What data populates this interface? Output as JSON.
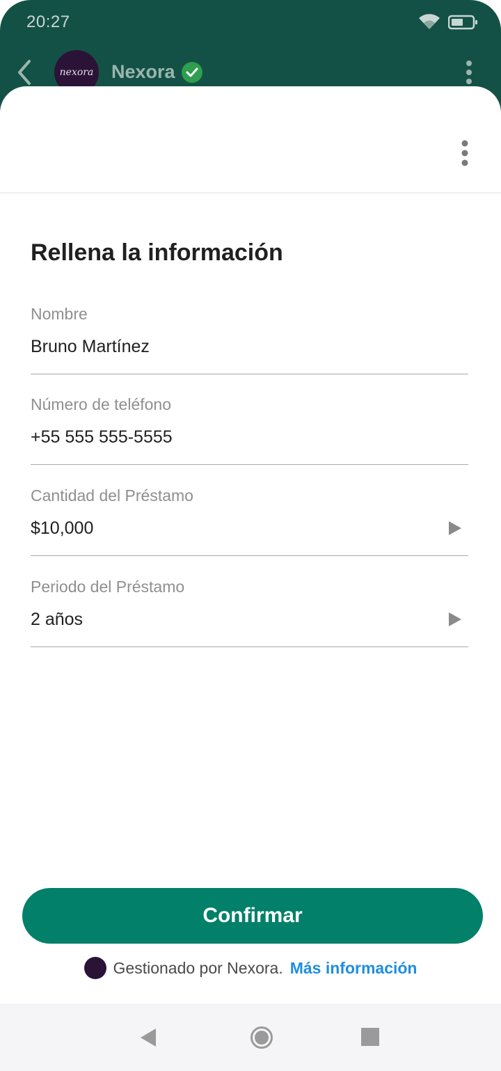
{
  "status_bar": {
    "time": "20:27"
  },
  "chat_header": {
    "title": "Nexora",
    "avatar_text": "nexora"
  },
  "form": {
    "title": "Rellena la información",
    "fields": [
      {
        "label": "Nombre",
        "value": "Bruno Martínez",
        "has_chevron": false
      },
      {
        "label": "Número de teléfono",
        "value": "+55 555 555-5555",
        "has_chevron": false
      },
      {
        "label": "Cantidad del Préstamo",
        "value": "$10,000",
        "has_chevron": true
      },
      {
        "label": "Periodo del Préstamo",
        "value": "2 años",
        "has_chevron": true
      }
    ]
  },
  "confirm_label": "Confirmar",
  "footer": {
    "managed_text": "Gestionado por Nexora.",
    "link_text": "Más información"
  },
  "colors": {
    "header_bg": "#135146",
    "accent": "#028069",
    "link": "#1f8de0",
    "verified": "#2e9e4f"
  },
  "icons": [
    "wifi-icon",
    "battery-icon",
    "back-arrow-icon",
    "verified-check-icon",
    "more-vert-icon",
    "chevron-right-icon",
    "nav-back-icon",
    "nav-home-icon",
    "nav-recents-icon"
  ]
}
